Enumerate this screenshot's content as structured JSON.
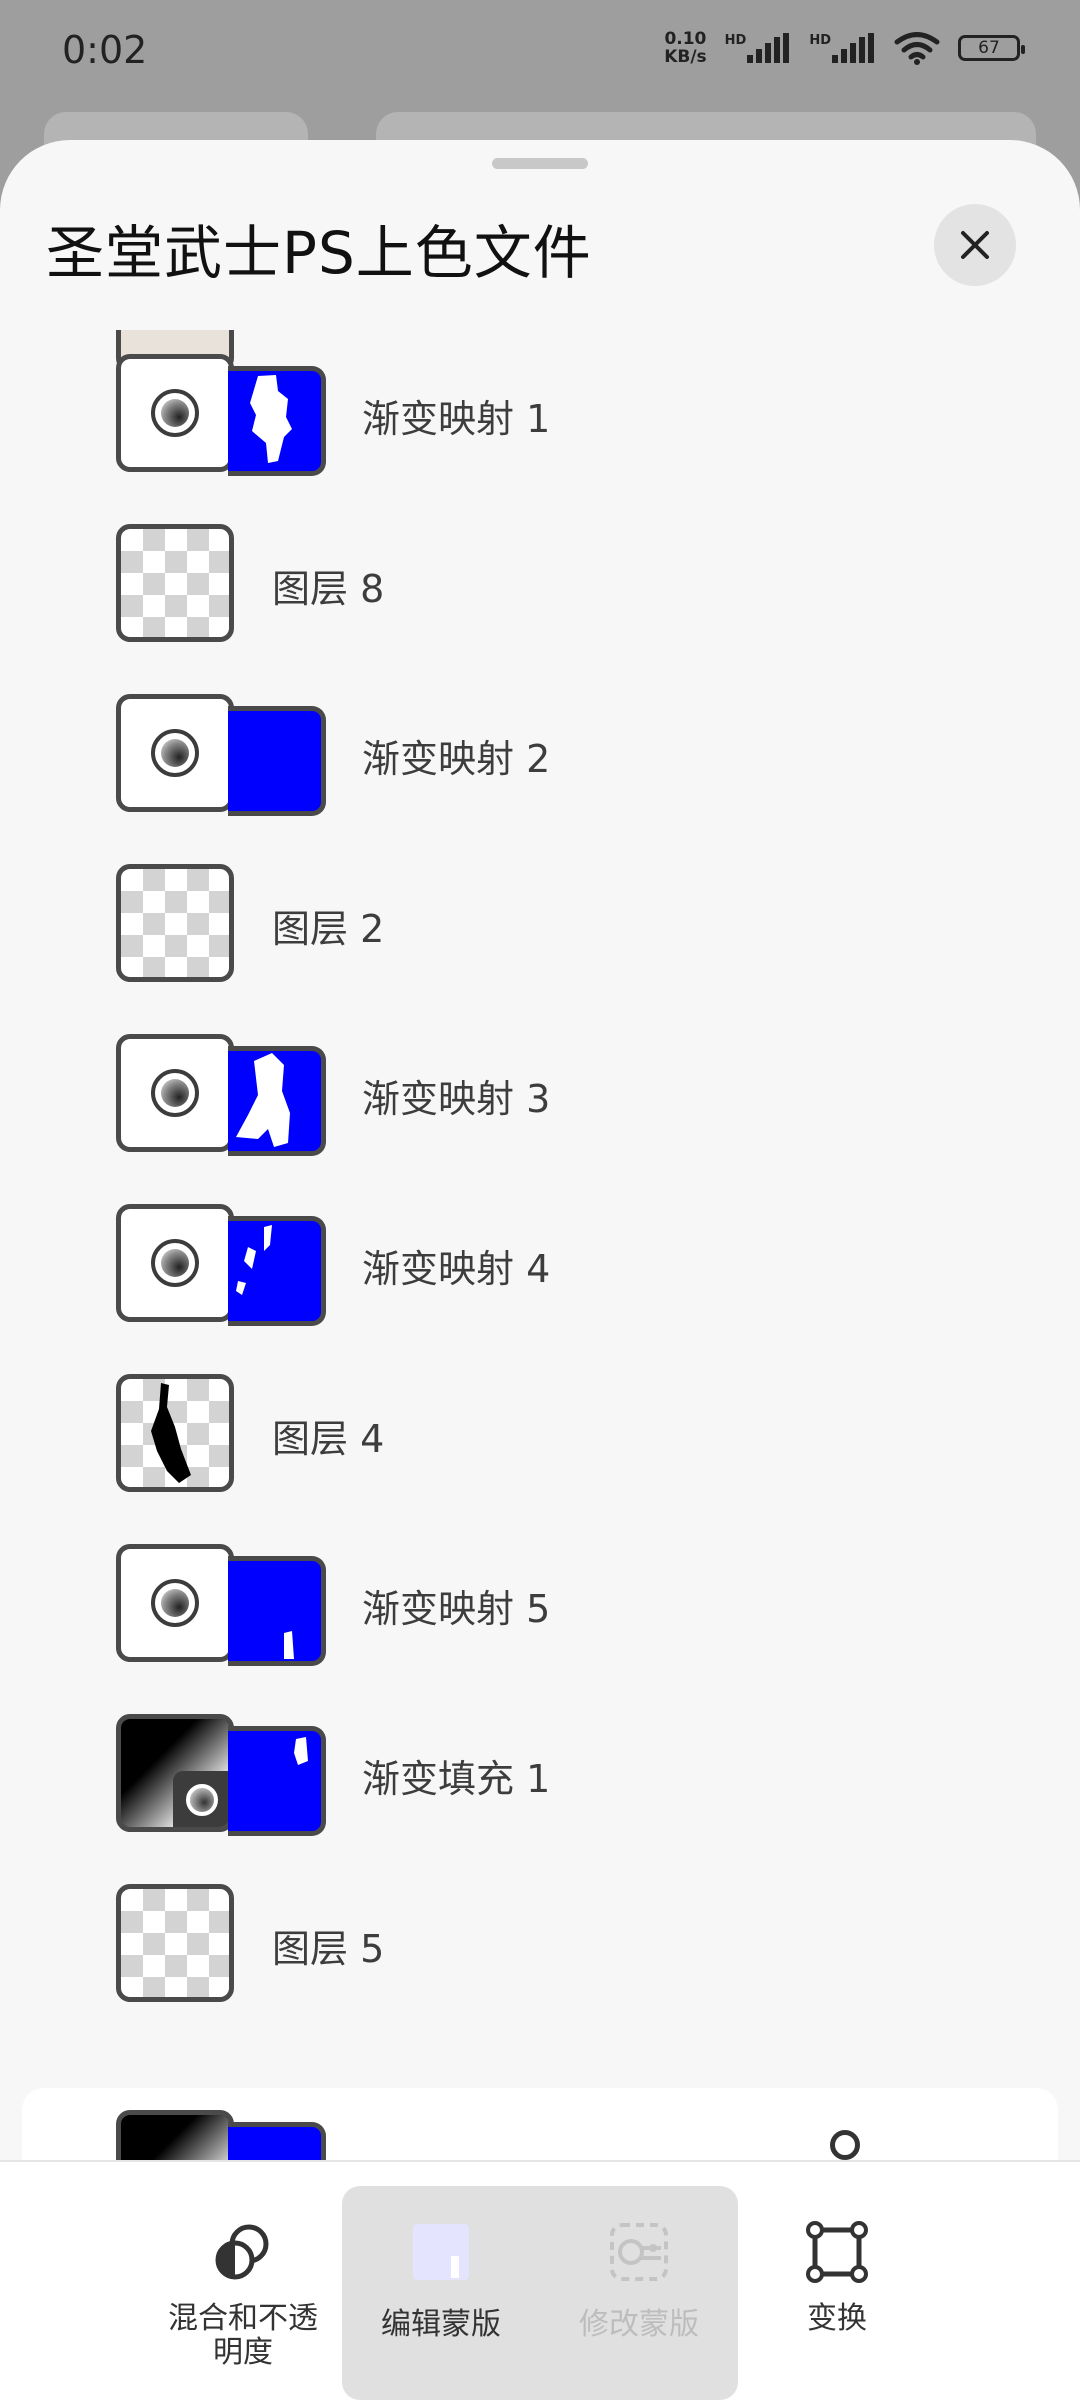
{
  "status": {
    "time": "0:02",
    "net_speed_value": "0.10",
    "net_speed_unit": "KB/s",
    "hd1": "HD",
    "hd2": "HD",
    "battery": "67"
  },
  "sheet": {
    "title": "圣堂武士PS上色文件"
  },
  "layers": [
    {
      "name": "渐变映射 1",
      "kind": "adjustment"
    },
    {
      "name": "图层 8",
      "kind": "pixel"
    },
    {
      "name": "渐变映射 2",
      "kind": "adjustment"
    },
    {
      "name": "图层 2",
      "kind": "pixel"
    },
    {
      "name": "渐变映射 3",
      "kind": "adjustment"
    },
    {
      "name": "渐变映射 4",
      "kind": "adjustment"
    },
    {
      "name": "图层 4",
      "kind": "pixel"
    },
    {
      "name": "渐变映射 5",
      "kind": "adjustment"
    },
    {
      "name": "渐变填充 1",
      "kind": "fill"
    },
    {
      "name": "图层 5",
      "kind": "pixel"
    }
  ],
  "toolbar": {
    "blend_label": "混合和不透明度",
    "edit_mask_label": "编辑蒙版",
    "modify_mask_label": "修改蒙版",
    "transform_label": "变换"
  },
  "colors": {
    "mask_blue": "#0000ff",
    "sheet_bg": "#f7f7f7"
  }
}
